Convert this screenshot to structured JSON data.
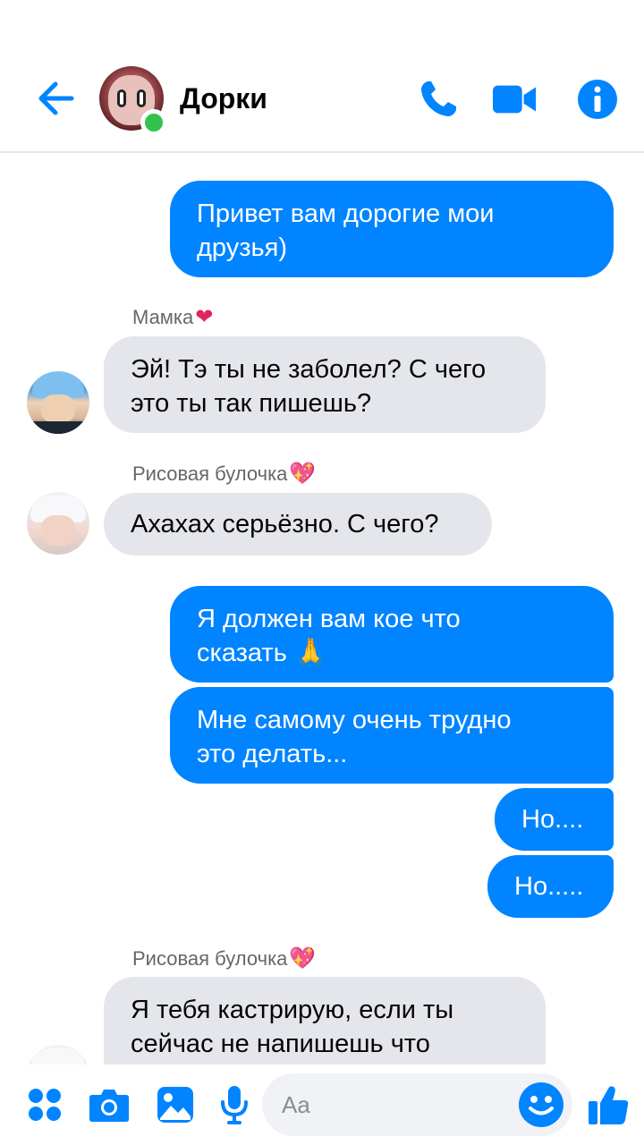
{
  "header": {
    "contact_name": "Дорки",
    "accent_color": "#0084ff",
    "online": true
  },
  "messages": [
    {
      "direction": "outgoing",
      "lines": [
        "Привет вам дорогие мои",
        "друзья)"
      ]
    },
    {
      "direction": "incoming",
      "sender": "Мамка",
      "sender_emoji": "❤",
      "lines": [
        "Эй! Тэ ты не заболел? С чего",
        "это ты так пишешь?"
      ]
    },
    {
      "direction": "incoming",
      "sender": "Рисовая булочка",
      "sender_emoji": "💖",
      "lines": [
        "Ахахах серьёзно. С чего?"
      ]
    },
    {
      "direction": "outgoing",
      "lines": [
        "Я должен вам кое что",
        "сказать"
      ],
      "emoji": "🙏"
    },
    {
      "direction": "outgoing",
      "lines": [
        "Мне самому очень трудно",
        "это делать..."
      ]
    },
    {
      "direction": "outgoing",
      "lines": [
        "Но...."
      ]
    },
    {
      "direction": "outgoing",
      "lines": [
        "Но....."
      ]
    },
    {
      "direction": "incoming",
      "sender": "Рисовая булочка",
      "sender_emoji": "💖",
      "lines": [
        "Я тебя кастрирую, если ты",
        "сейчас не напишешь что"
      ]
    }
  ],
  "composer": {
    "placeholder": "Aa"
  }
}
